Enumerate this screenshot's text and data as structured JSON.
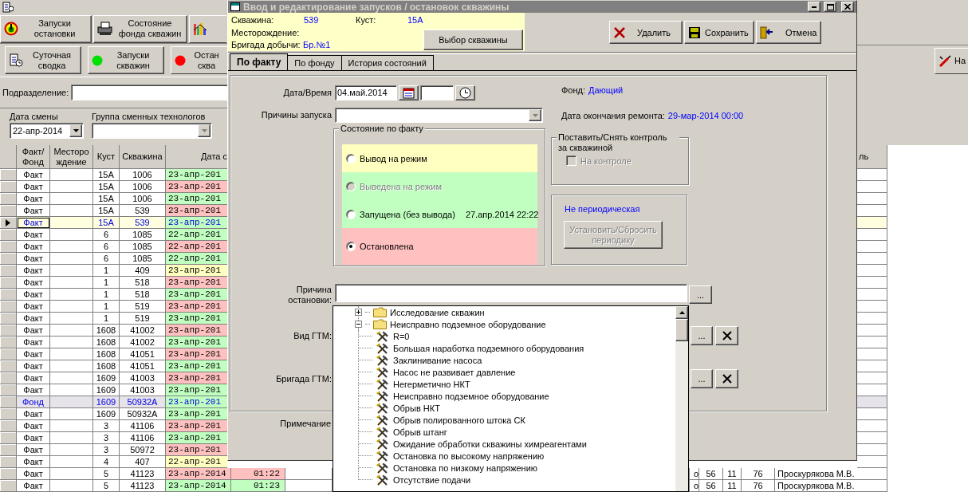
{
  "main_window": {
    "toolbar_top": [
      {
        "label": "Запуски\nостановки",
        "kind": "gauge"
      },
      {
        "label": "Состояние\nфонда скважин",
        "kind": "printer"
      },
      {
        "kind": "chart"
      }
    ],
    "toolbar_second": [
      {
        "label": "Суточная\nсводка",
        "kind": "report"
      },
      {
        "label": "Запуски\nскважин",
        "kind": "start"
      },
      {
        "label": "Остан\nсква",
        "kind": "stop"
      }
    ],
    "toolbar_right": {
      "label": "На"
    },
    "division": {
      "label": "Подразделение:"
    },
    "shift_date": {
      "label": "Дата смены",
      "value": "22-апр-2014"
    },
    "tech_group": {
      "label": "Группа сменных технологов"
    },
    "table": {
      "columns": [
        "Факт/\nФонд",
        "Месторо\nждение",
        "Куст",
        "Скважина",
        "Дата с"
      ],
      "column_right": "ль",
      "rows": [
        {
          "type": "Факт",
          "kind": "fact",
          "bush": "15А",
          "well": "1006",
          "date": "23-апр-201",
          "color": "#c0ffc0",
          "selected": false
        },
        {
          "type": "Факт",
          "kind": "fact",
          "bush": "15А",
          "well": "1006",
          "date": "23-апр-201",
          "color": "#ffc0c0",
          "selected": false
        },
        {
          "type": "Факт",
          "kind": "fact",
          "bush": "15А",
          "well": "1006",
          "date": "23-апр-201",
          "color": "#c0ffc0",
          "selected": false
        },
        {
          "type": "Факт",
          "kind": "fact",
          "bush": "15А",
          "well": "539",
          "date": "23-апр-201",
          "color": "#ffc0c0",
          "selected": false
        },
        {
          "type": "Факт",
          "kind": "fact",
          "bush": "15А",
          "well": "539",
          "date": "23-апр-201",
          "color": "#c0ffc0",
          "selected": true
        },
        {
          "type": "Факт",
          "kind": "fact",
          "bush": "6",
          "well": "1085",
          "date": "22-апр-201",
          "color": "#c0ffc0",
          "selected": false
        },
        {
          "type": "Факт",
          "kind": "fact",
          "bush": "6",
          "well": "1085",
          "date": "22-апр-201",
          "color": "#ffc0c0",
          "selected": false
        },
        {
          "type": "Факт",
          "kind": "fact",
          "bush": "6",
          "well": "1085",
          "date": "22-апр-201",
          "color": "#c0ffc0",
          "selected": false
        },
        {
          "type": "Факт",
          "kind": "fact",
          "bush": "1",
          "well": "409",
          "date": "23-апр-201",
          "color": "#ffffc0",
          "selected": false
        },
        {
          "type": "Факт",
          "kind": "fact",
          "bush": "1",
          "well": "518",
          "date": "23-апр-201",
          "color": "#ffc0c0",
          "selected": false
        },
        {
          "type": "Факт",
          "kind": "fact",
          "bush": "1",
          "well": "518",
          "date": "23-апр-201",
          "color": "#c0ffc0",
          "selected": false
        },
        {
          "type": "Факт",
          "kind": "fact",
          "bush": "1",
          "well": "519",
          "date": "23-апр-201",
          "color": "#ffc0c0",
          "selected": false
        },
        {
          "type": "Факт",
          "kind": "fact",
          "bush": "1",
          "well": "519",
          "date": "23-апр-201",
          "color": "#c0ffc0",
          "selected": false
        },
        {
          "type": "Факт",
          "kind": "fact",
          "bush": "1608",
          "well": "41002",
          "date": "23-апр-201",
          "color": "#ffc0c0",
          "selected": false
        },
        {
          "type": "Факт",
          "kind": "fact",
          "bush": "1608",
          "well": "41002",
          "date": "23-апр-201",
          "color": "#c0ffc0",
          "selected": false
        },
        {
          "type": "Факт",
          "kind": "fact",
          "bush": "1608",
          "well": "41051",
          "date": "23-апр-201",
          "color": "#ffc0c0",
          "selected": false
        },
        {
          "type": "Факт",
          "kind": "fact",
          "bush": "1608",
          "well": "41051",
          "date": "23-апр-201",
          "color": "#c0ffc0",
          "selected": false
        },
        {
          "type": "Факт",
          "kind": "fact",
          "bush": "1609",
          "well": "41003",
          "date": "23-апр-201",
          "color": "#ffc0c0",
          "selected": false
        },
        {
          "type": "Факт",
          "kind": "fact",
          "bush": "1609",
          "well": "41003",
          "date": "23-апр-201",
          "color": "#c0ffc0",
          "selected": false
        },
        {
          "type": "Фонд",
          "kind": "fund",
          "bush": "1609",
          "well": "50932А",
          "date": "23-апр-201",
          "color": "#c0ffc0",
          "selected": false
        },
        {
          "type": "Факт",
          "kind": "fact",
          "bush": "1609",
          "well": "50932А",
          "date": "23-апр-201",
          "color": "#c0ffc0",
          "selected": false
        },
        {
          "type": "Факт",
          "kind": "fact",
          "bush": "3",
          "well": "41106",
          "date": "23-апр-201",
          "color": "#ffc0c0",
          "selected": false
        },
        {
          "type": "Факт",
          "kind": "fact",
          "bush": "3",
          "well": "41106",
          "date": "23-апр-201",
          "color": "#c0ffc0",
          "selected": false
        },
        {
          "type": "Факт",
          "kind": "fact",
          "bush": "3",
          "well": "50972",
          "date": "23-апр-201",
          "color": "#ffc0c0",
          "selected": false
        },
        {
          "type": "Факт",
          "kind": "fact",
          "bush": "4",
          "well": "407",
          "date": "22-апр-201",
          "color": "#ffffc0",
          "selected": false
        },
        {
          "type": "Факт",
          "kind": "fact",
          "bush": "5",
          "well": "41123",
          "date": "23-апр-2014",
          "time": "01:22",
          "color": "#ffc0c0",
          "selected": false,
          "extra": [
            "о",
            "56",
            "11",
            "76",
            "Проскурякова М.В."
          ]
        },
        {
          "type": "Факт",
          "kind": "fact",
          "bush": "5",
          "well": "41123",
          "date": "23-апр-2014",
          "time": "01:23",
          "color": "#c0ffc0",
          "selected": false,
          "extra": [
            "о",
            "56",
            "11",
            "76",
            "Проскурякова М.В."
          ]
        }
      ]
    }
  },
  "dialog": {
    "title": "Ввод и редактирование запусков / остановок скважины",
    "info_rows": [
      [
        {
          "label": "Скважина:",
          "value": "539"
        },
        {
          "label": "Куст:",
          "value": "15А"
        }
      ],
      [
        {
          "label": "Месторождение:"
        }
      ],
      [
        {
          "label": "Бригада добычи:",
          "value": "Бр.№1"
        }
      ]
    ],
    "select_button": "Выбор скважины",
    "actions": [
      {
        "label": "Удалить",
        "kind": "delete"
      },
      {
        "label": "Сохранить",
        "kind": "save"
      },
      {
        "label": "Отмена",
        "kind": "cancel"
      }
    ],
    "tabs": [
      {
        "label": "По факту",
        "selected": true
      },
      {
        "label": "По фонду",
        "selected": false
      },
      {
        "label": "История состояний",
        "selected": false
      }
    ],
    "datetime": {
      "label": "Дата/Время",
      "date": "04.май.2014"
    },
    "start_reason": {
      "label": "Причины запуска"
    },
    "fund": {
      "label": "Фонд:",
      "value": "Дающий"
    },
    "repair_end": {
      "label": "Дата окончания ремонта:",
      "value": "29-мар-2014 00:00"
    },
    "state_group": {
      "title": "Состояние по факту",
      "options": [
        {
          "label": "Вывод на режим",
          "selected": false,
          "disabled": false,
          "color": "#ffffc0"
        },
        {
          "label": "Выведена на режим",
          "selected": false,
          "disabled": true,
          "color": "#c0ffc0"
        },
        {
          "label": "Запущена (без вывода)",
          "selected": false,
          "disabled": false,
          "color": "#c0ffc0",
          "datetime": "27.апр.2014 22:22"
        },
        {
          "label": "Остановлена",
          "selected": true,
          "disabled": false,
          "color": "#ffc0c0"
        }
      ]
    },
    "control_group": {
      "title": "Поставить/Снять контроль за скважиной",
      "checkbox": {
        "label": "На контроле",
        "checked": false,
        "disabled": true
      }
    },
    "periodic_group": {
      "status": "Не периодическая",
      "button": {
        "label": "Установить/Сбросить\nпериодику",
        "disabled": true
      }
    },
    "stop_reason": {
      "label": "Причина\nостановки:",
      "button": "..."
    },
    "gtm_type": {
      "label": "Вид ГТМ:",
      "button": "..."
    },
    "gtm_crew": {
      "label": "Бригада ГТМ:",
      "button": "..."
    },
    "note": {
      "label": "Примечание"
    }
  },
  "dropdown_tree": {
    "items": [
      {
        "label": "Исследование скважин",
        "expanded": false
      },
      {
        "label": "Неисправно подземное оборудование",
        "expanded": true,
        "children": [
          {
            "label": "R=0"
          },
          {
            "label": "Большая наработка подземного оборудования"
          },
          {
            "label": "Заклинивание насоса"
          },
          {
            "label": "Насос не развивает давление"
          },
          {
            "label": "Негерметично НКТ"
          },
          {
            "label": "Неисправно подземное оборудование"
          },
          {
            "label": "Обрыв НКТ"
          },
          {
            "label": "Обрыв полированного штока СК"
          },
          {
            "label": "Обрыв штанг"
          },
          {
            "label": "Ожидание обработки скважины химреагентами"
          },
          {
            "label": "Остановка по высокому напряжению"
          },
          {
            "label": "Остановка по низкому напряжению"
          },
          {
            "label": "Отсутствие подачи"
          }
        ]
      }
    ]
  }
}
